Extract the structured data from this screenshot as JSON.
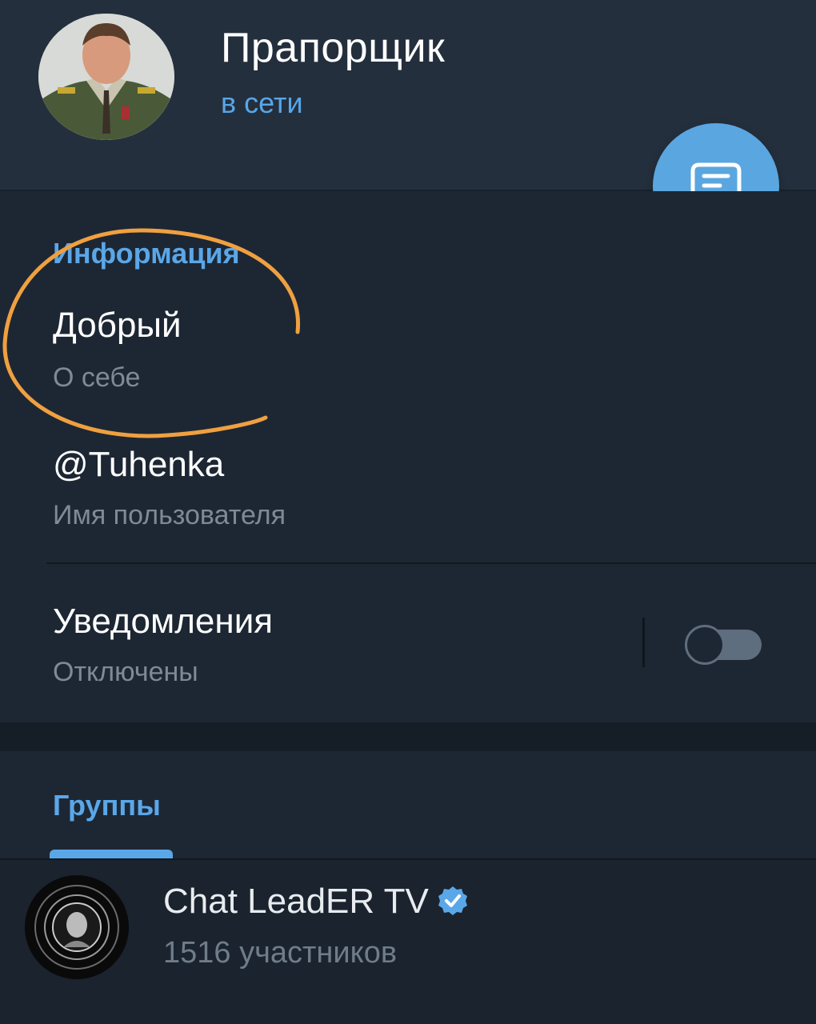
{
  "header": {
    "title": "Прапорщик",
    "status": "в сети"
  },
  "info": {
    "heading": "Информация",
    "bio": {
      "value": "Добрый",
      "label": "О себе"
    },
    "username": {
      "value": "@Tuhenka",
      "label": "Имя пользователя"
    },
    "notifications": {
      "value": "Уведомления",
      "label": "Отключены",
      "enabled": false
    }
  },
  "groups": {
    "tab_label": "Группы",
    "items": [
      {
        "name": "Chat LeadER TV",
        "members": "1516 участников",
        "verified": true
      }
    ]
  },
  "colors": {
    "accent": "#5aa7e8",
    "background": "#1d2733",
    "header_bg": "#242f3d",
    "annotation": "#f0a040"
  }
}
